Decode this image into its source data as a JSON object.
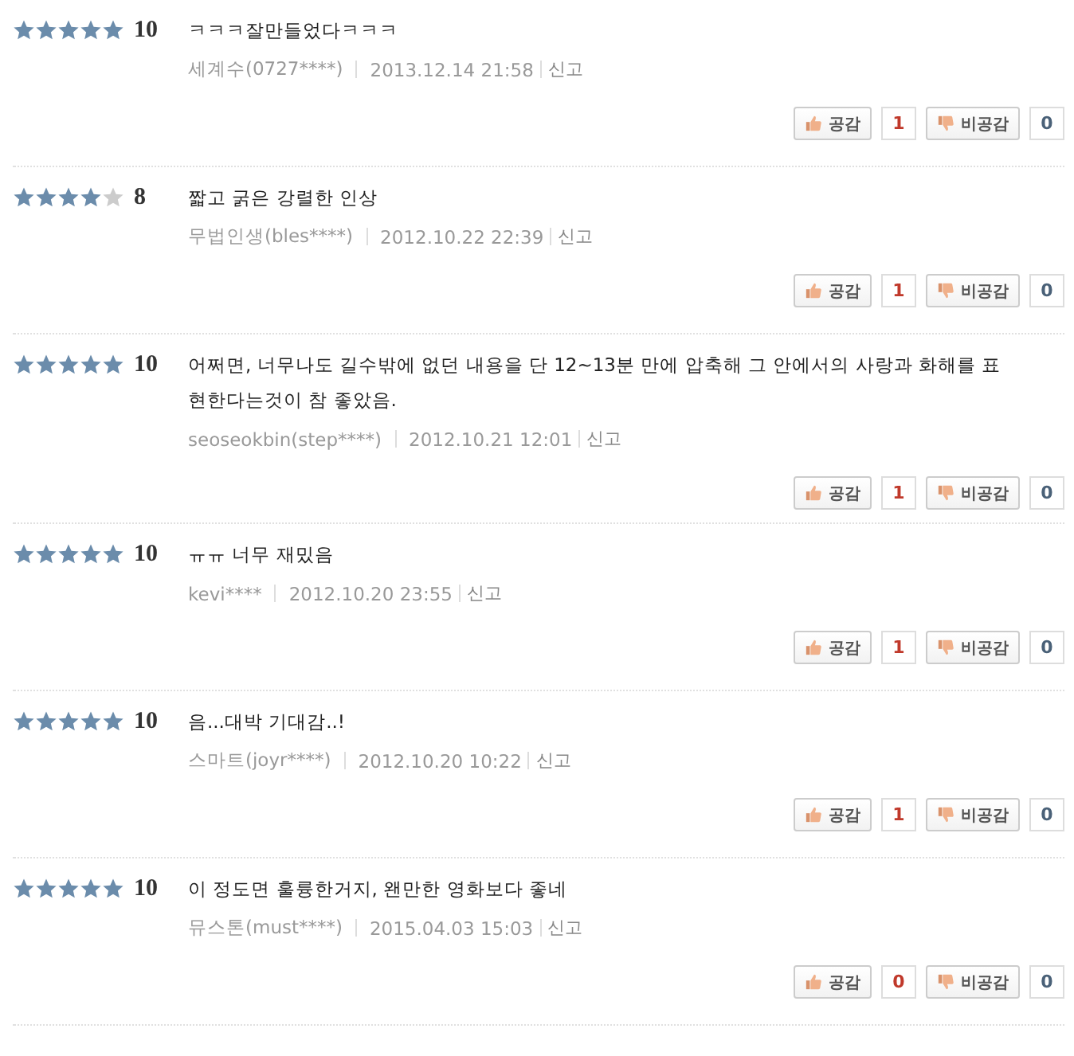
{
  "reviews": [
    {
      "stars": 5,
      "score": "10",
      "text": "ㅋㅋㅋ잘만들었다ㅋㅋㅋ",
      "author": "세계수(0727****)",
      "date": "2013.12.14 21:58",
      "report": "신고",
      "like_label": "공감",
      "likes": "1",
      "dislike_label": "비공감",
      "dislikes": "0"
    },
    {
      "stars": 4,
      "score": "8",
      "text": "짧고 굵은 강렬한 인상",
      "author": "무법인생(bles****)",
      "date": "2012.10.22 22:39",
      "report": "신고",
      "like_label": "공감",
      "likes": "1",
      "dislike_label": "비공감",
      "dislikes": "0"
    },
    {
      "stars": 5,
      "score": "10",
      "text": "어쩌면, 너무나도 길수밖에 없던 내용을 단 12~13분 만에 압축해 그 안에서의 사랑과 화해를 표현한다는것이 참 좋았음.",
      "author": "seoseokbin(step****)",
      "date": "2012.10.21 12:01",
      "report": "신고",
      "like_label": "공감",
      "likes": "1",
      "dislike_label": "비공감",
      "dislikes": "0"
    },
    {
      "stars": 5,
      "score": "10",
      "text": "ㅠㅠ 너무 재밌음",
      "author": "kevi****",
      "date": "2012.10.20 23:55",
      "report": "신고",
      "like_label": "공감",
      "likes": "1",
      "dislike_label": "비공감",
      "dislikes": "0"
    },
    {
      "stars": 5,
      "score": "10",
      "text": "음...대박 기대감..!",
      "author": "스마트(joyr****)",
      "date": "2012.10.20 10:22",
      "report": "신고",
      "like_label": "공감",
      "likes": "1",
      "dislike_label": "비공감",
      "dislikes": "0"
    },
    {
      "stars": 5,
      "score": "10",
      "text": "이 정도면 훌륭한거지, 왠만한 영화보다 좋네",
      "author": "뮤스톤(must****)",
      "date": "2015.04.03 15:03",
      "report": "신고",
      "like_label": "공감",
      "likes": "0",
      "dislike_label": "비공감",
      "dislikes": "0"
    }
  ]
}
